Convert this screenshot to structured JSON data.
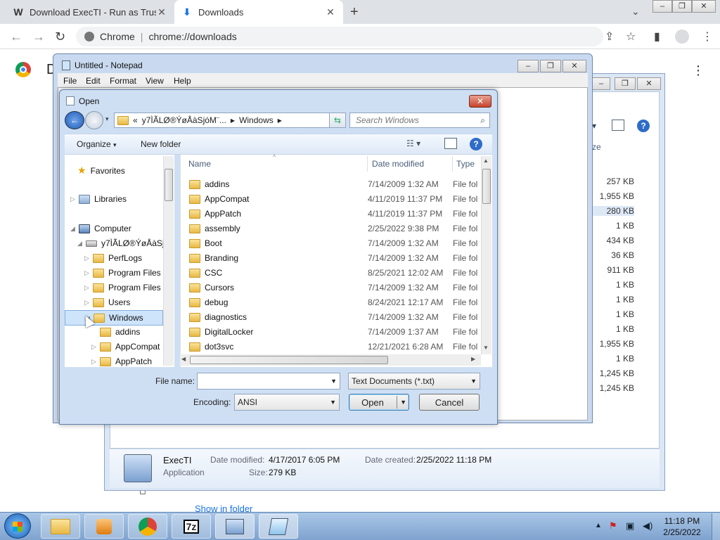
{
  "browser": {
    "tabs": [
      {
        "icon_text": "W",
        "title": "Download ExecTI - Run as Trusted"
      },
      {
        "icon_text": "⬇",
        "title": "Downloads"
      }
    ],
    "address_site": "Chrome",
    "address_url": "chrome://downloads",
    "page_title_partial": "D",
    "show_in_folder": "Show in folder"
  },
  "explorer_back": {
    "sizes": [
      "257 KB",
      "1,955 KB",
      "280 KB",
      "1 KB",
      "434 KB",
      "36 KB",
      "911 KB",
      "1 KB",
      "1 KB",
      "1 KB",
      "1 KB",
      "1,955 KB",
      "1 KB",
      "1,245 KB",
      "1,245 KB"
    ],
    "col_partial": "ze",
    "details": {
      "name": "ExecTI",
      "kind": "Application",
      "date_modified_label": "Date modified:",
      "date_modified": "4/17/2017 6:05 PM",
      "size_label": "Size:",
      "size": "279 KB",
      "date_created_label": "Date created:",
      "date_created": "2/25/2022 11:18 PM"
    }
  },
  "notepad": {
    "title": "Untitled - Notepad",
    "menu": [
      "File",
      "Edit",
      "Format",
      "View",
      "Help"
    ]
  },
  "open_dialog": {
    "title": "Open",
    "breadcrumb": [
      "«",
      "y7ÌÃLØ®ÝøÅàSjóM¨...",
      "Windows"
    ],
    "search_placeholder": "Search Windows",
    "organize": "Organize",
    "new_folder": "New folder",
    "nav": {
      "favorites": "Favorites",
      "libraries": "Libraries",
      "computer": "Computer",
      "drive": "y7ÌÃLØ®ÝøÅàSj",
      "children": [
        "PerfLogs",
        "Program Files",
        "Program Files (",
        "Users",
        "Windows",
        "addins",
        "AppCompat",
        "AppPatch"
      ]
    },
    "columns": {
      "name": "Name",
      "date": "Date modified",
      "type": "Type"
    },
    "files": [
      {
        "name": "addins",
        "date": "7/14/2009 1:32 AM",
        "type": "File fol"
      },
      {
        "name": "AppCompat",
        "date": "4/11/2019 11:37 PM",
        "type": "File fol"
      },
      {
        "name": "AppPatch",
        "date": "4/11/2019 11:37 PM",
        "type": "File fol"
      },
      {
        "name": "assembly",
        "date": "2/25/2022 9:38 PM",
        "type": "File fol"
      },
      {
        "name": "Boot",
        "date": "7/14/2009 1:32 AM",
        "type": "File fol"
      },
      {
        "name": "Branding",
        "date": "7/14/2009 1:32 AM",
        "type": "File fol"
      },
      {
        "name": "CSC",
        "date": "8/25/2021 12:02 AM",
        "type": "File fol"
      },
      {
        "name": "Cursors",
        "date": "7/14/2009 1:32 AM",
        "type": "File fol"
      },
      {
        "name": "debug",
        "date": "8/24/2021 12:17 AM",
        "type": "File fol"
      },
      {
        "name": "diagnostics",
        "date": "7/14/2009 1:32 AM",
        "type": "File fol"
      },
      {
        "name": "DigitalLocker",
        "date": "7/14/2009 1:37 AM",
        "type": "File fol"
      },
      {
        "name": "dot3svc",
        "date": "12/21/2021 6:28 AM",
        "type": "File fol"
      }
    ],
    "file_name_label": "File name:",
    "file_name_value": "",
    "file_type": "Text Documents (*.txt)",
    "encoding_label": "Encoding:",
    "encoding": "ANSI",
    "open_btn": "Open",
    "cancel_btn": "Cancel"
  },
  "taskbar": {
    "time": "11:18 PM",
    "date": "2/25/2022",
    "apps": [
      "explorer",
      "media-player",
      "chrome",
      "7zip",
      "execti",
      "notepad"
    ]
  }
}
